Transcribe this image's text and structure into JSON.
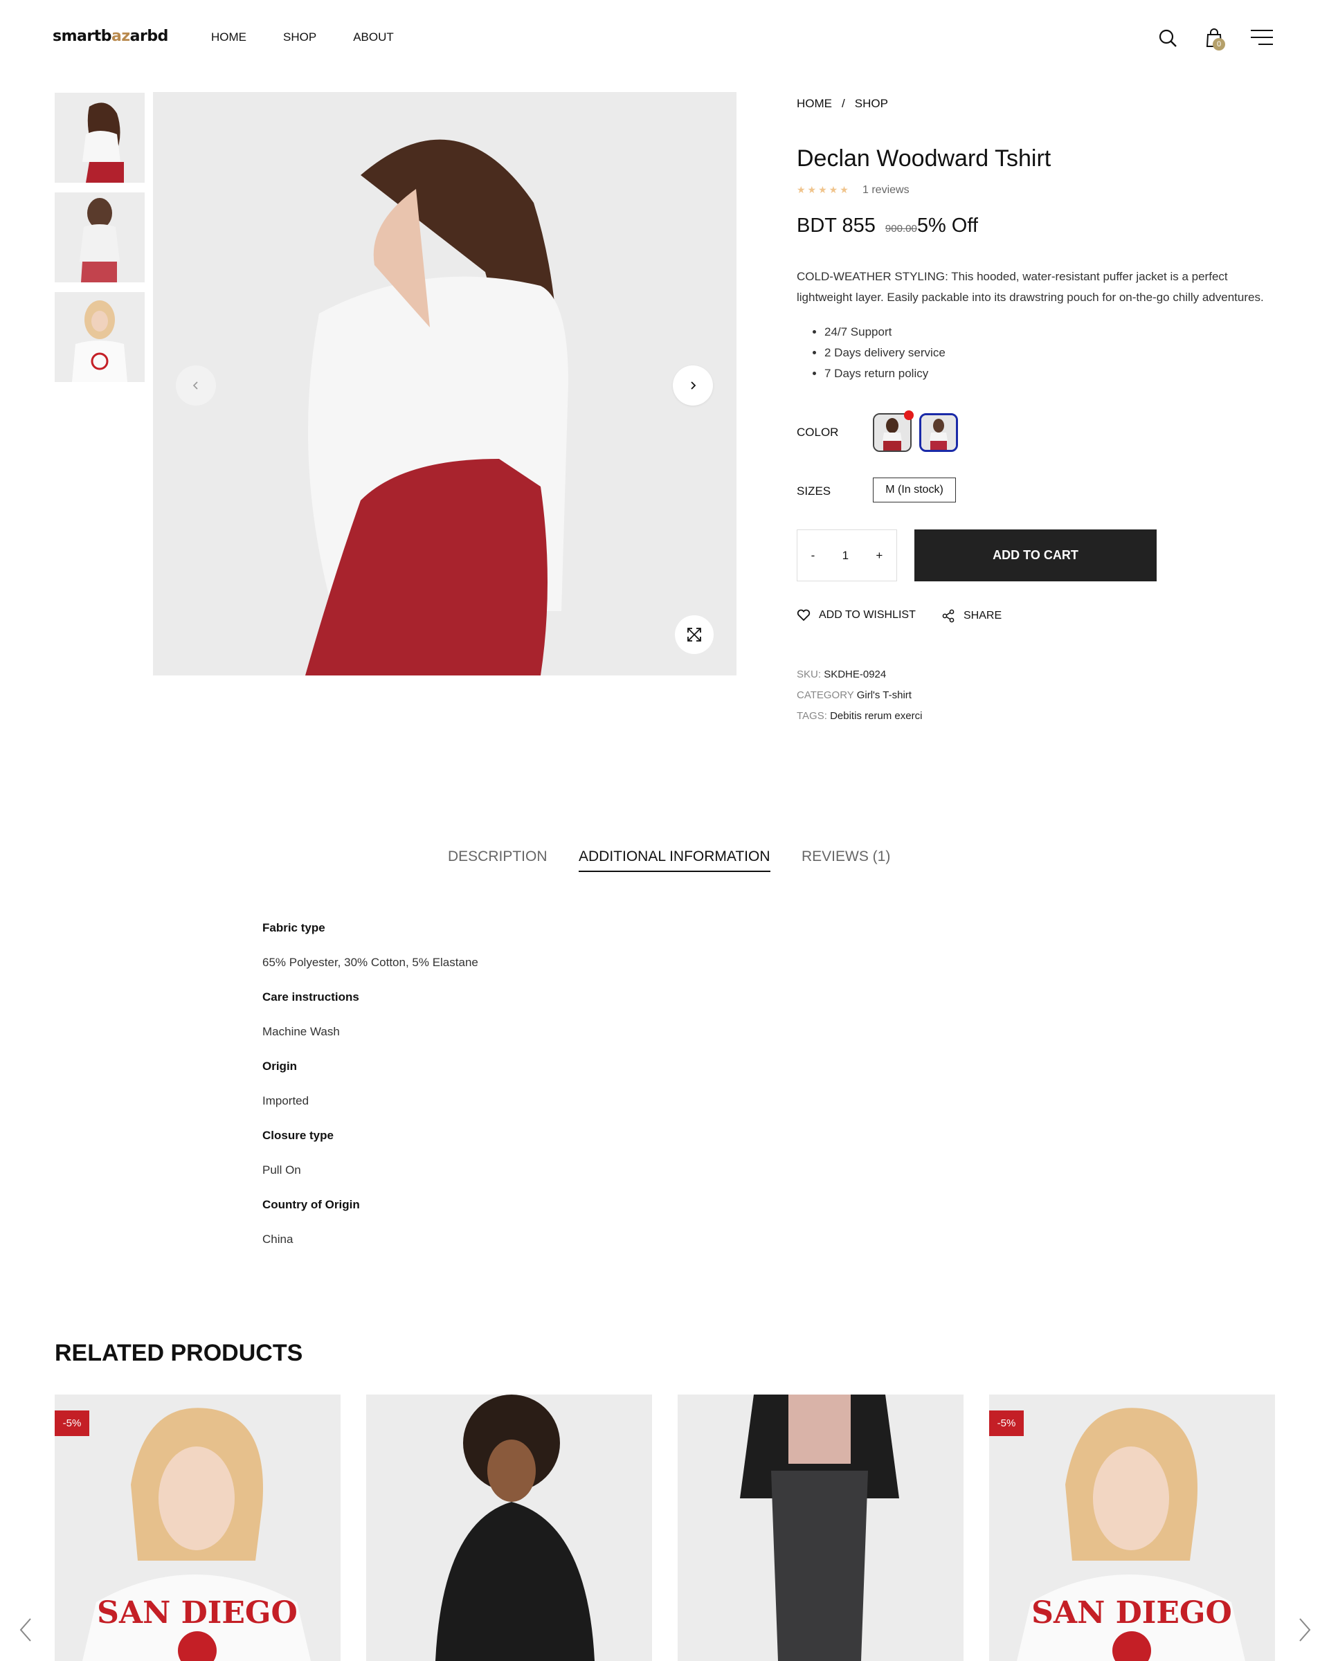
{
  "brand": {
    "logo_pre": "smartb",
    "logo_accent": "az",
    "logo_post": "arbd"
  },
  "nav": [
    "HOME",
    "SHOP",
    "ABOUT"
  ],
  "cart": {
    "count": "0"
  },
  "product": {
    "breadcrumb": [
      "HOME",
      "/",
      "SHOP"
    ],
    "title": "Declan Woodward Tshirt",
    "stars": "★★★★★",
    "reviews": "1 reviews",
    "price": "BDT 855",
    "old_price": "900.00",
    "discount": "5% Off",
    "description": "COLD-WEATHER STYLING: This hooded, water-resistant puffer jacket is a perfect lightweight layer. Easily packable into its drawstring pouch for on-the-go chilly adventures.",
    "features": [
      "24/7 Support",
      "2 Days delivery service",
      "7 Days return policy"
    ],
    "color_label": "COLOR",
    "sizes_label": "SIZES",
    "size_option": "M (In stock)",
    "quantity": "1",
    "qty_minus": "-",
    "qty_plus": "+",
    "add_to_cart": "ADD TO CART",
    "wishlist": "ADD TO WISHLIST",
    "share": "SHARE",
    "sku_label": "SKU:",
    "sku": "SKDHE-0924",
    "category_label": "CATEGORY",
    "category": "Girl's T-shirt",
    "tags_label": "TAGS:",
    "tags": "Debitis rerum exerci"
  },
  "tabs": [
    "DESCRIPTION",
    "ADDITIONAL INFORMATION",
    "REVIEWS (1)"
  ],
  "active_tab": "ADDITIONAL INFORMATION",
  "additional_info": [
    {
      "label": "Fabric type",
      "value": "65% Polyester, 30% Cotton, 5% Elastane"
    },
    {
      "label": "Care instructions",
      "value": "Machine Wash"
    },
    {
      "label": "Origin",
      "value": "Imported"
    },
    {
      "label": "Closure type",
      "value": "Pull On"
    },
    {
      "label": "Country of Origin",
      "value": "China"
    }
  ],
  "related": {
    "title_light": "RELATED",
    "title_bold": "PRODUCTS",
    "cards": [
      {
        "badge": "-5%"
      },
      {
        "badge": ""
      },
      {
        "badge": ""
      },
      {
        "badge": "-5%"
      }
    ]
  },
  "colors": {
    "accent": "#b98a4e",
    "badge": "#c41f26",
    "button": "#222222",
    "selected_swatch": "#1a2aa8"
  }
}
